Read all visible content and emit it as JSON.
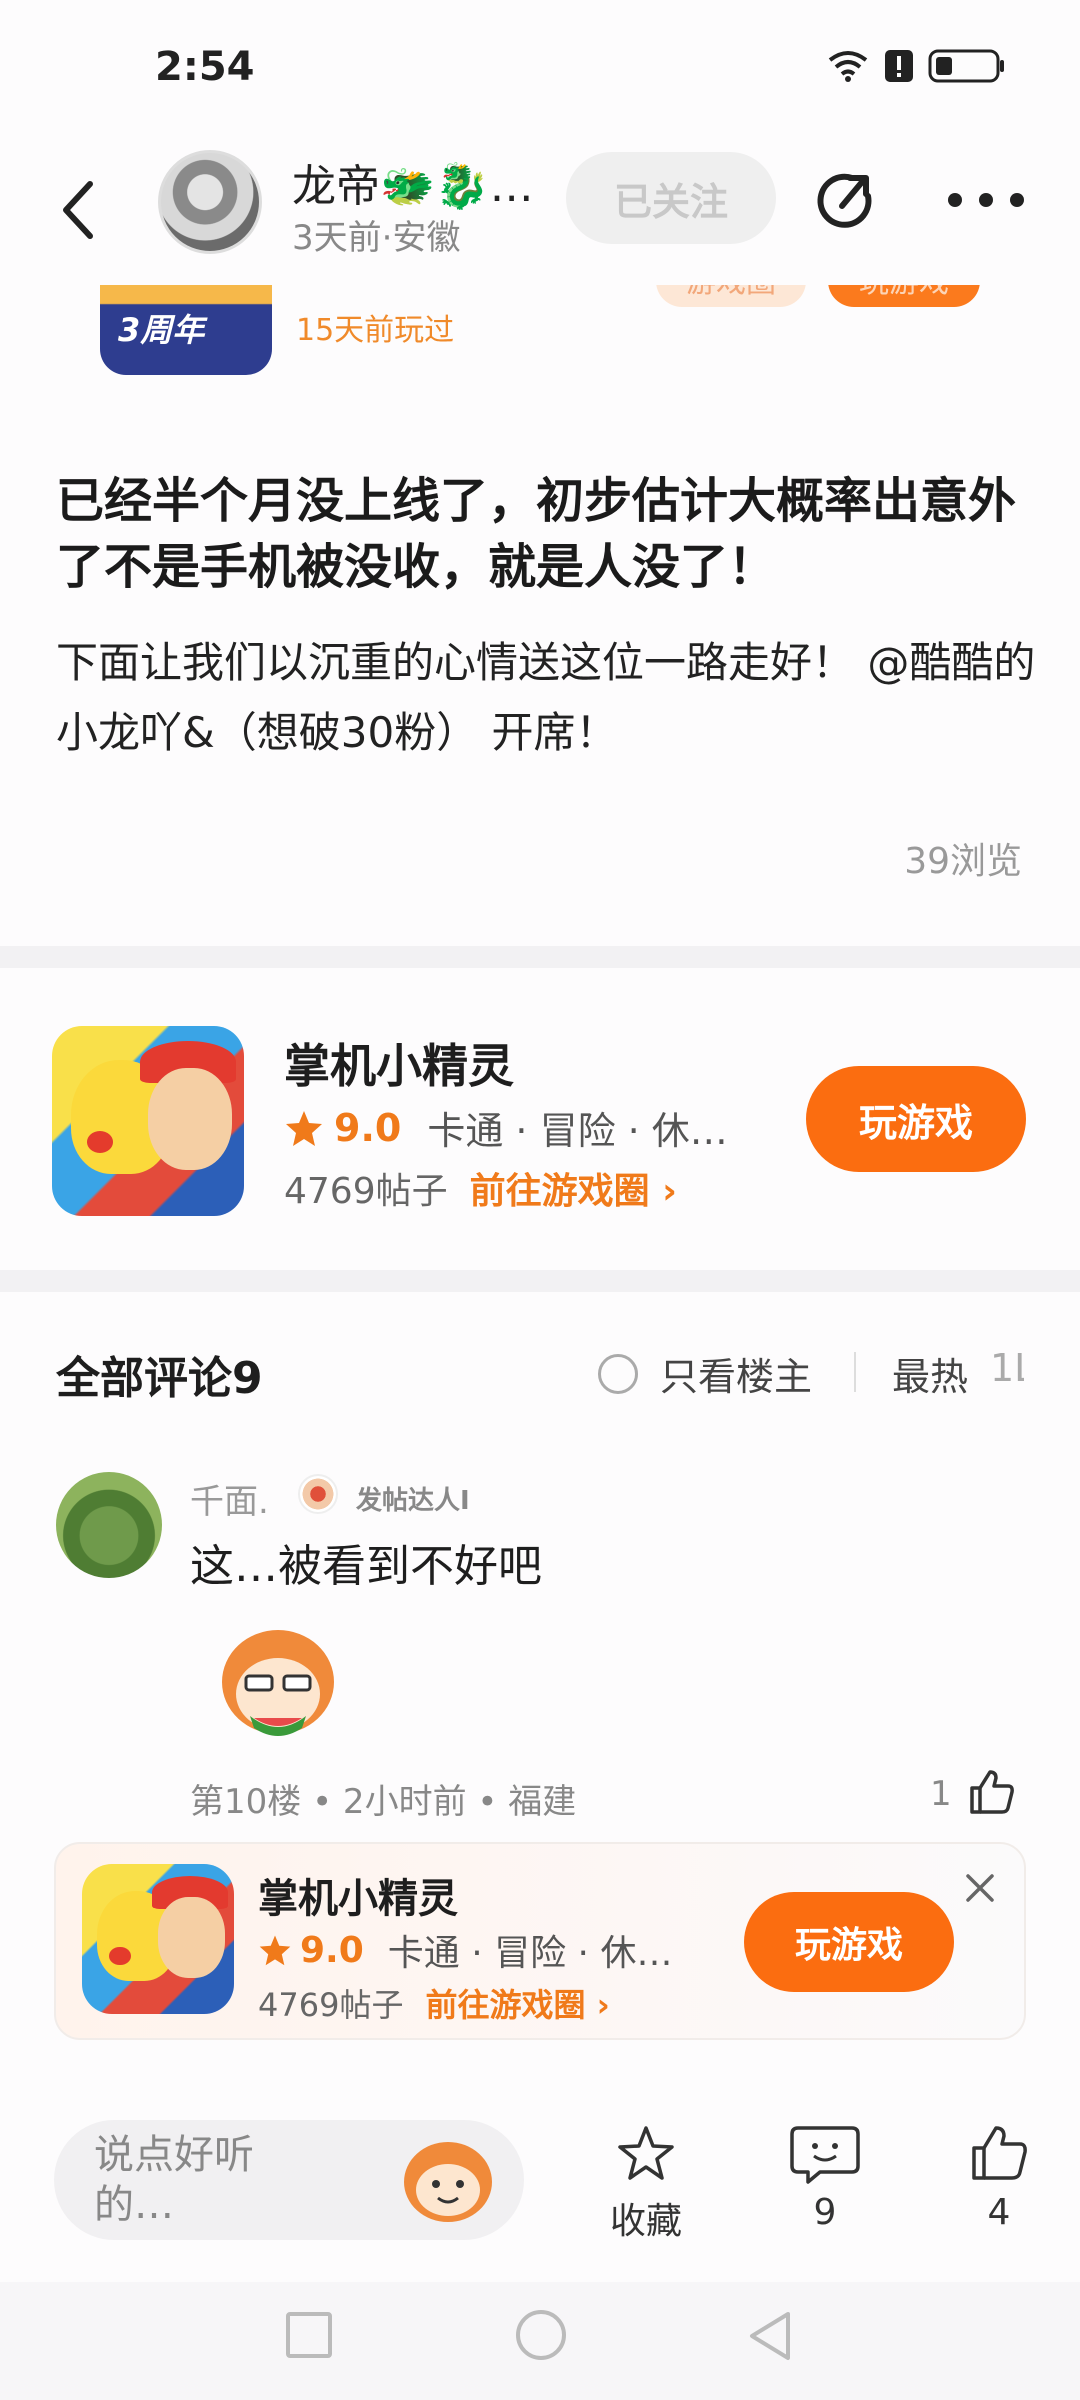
{
  "status_bar": {
    "time": "2:54"
  },
  "header": {
    "author_name": "龙帝🐲🐉…",
    "author_meta": "3天前·安徽",
    "follow_label": "已关注"
  },
  "prev_card": {
    "game_icon_label": "3周年",
    "played_text": "15天前玩过",
    "circle_label": "游戏圈",
    "play_label": "玩游戏"
  },
  "post": {
    "title": "已经半个月没上线了，初步估计大概率出意外了不是手机被没收，就是人没了！",
    "body": "下面让我们以沉重的心情送这位一路走好！ @酷酷的小龙吖&（想破30粉） 开席！",
    "views": "39浏览"
  },
  "game_card": {
    "name": "掌机小精灵",
    "rating": "9.0",
    "tags": "卡通 · 冒险 · 休…",
    "posts": "4769帖子",
    "circle_link": "前往游戏圈 ›",
    "play_label": "玩游戏"
  },
  "comments": {
    "title": "全部评论9",
    "only_op": "只看楼主",
    "sort_hot": "最热",
    "sort_new": "1L",
    "items": [
      {
        "user": "千面.",
        "badge": "发帖达人I",
        "text": "这…被看到不好吧",
        "meta": "第10楼 • 2小时前 • 福建",
        "likes": "1"
      }
    ]
  },
  "banner": {
    "name": "掌机小精灵",
    "rating": "9.0",
    "tags": "卡通 · 冒险 · 休…",
    "posts": "4769帖子",
    "circle_link": "前往游戏圈 ›",
    "play_label": "玩游戏"
  },
  "bottom_bar": {
    "reply_placeholder": "说点好听的…",
    "fav_label": "收藏",
    "comment_count": "9",
    "like_count": "4"
  },
  "colors": {
    "accent": "#fb6d10",
    "accent_text": "#f07a1a",
    "divider": "#f2f1f3"
  },
  "icons": [
    "back-icon",
    "share-icon",
    "more-icon",
    "star-icon",
    "thumbs-up-icon",
    "close-icon",
    "comment-icon",
    "wifi-icon",
    "battery-icon"
  ]
}
